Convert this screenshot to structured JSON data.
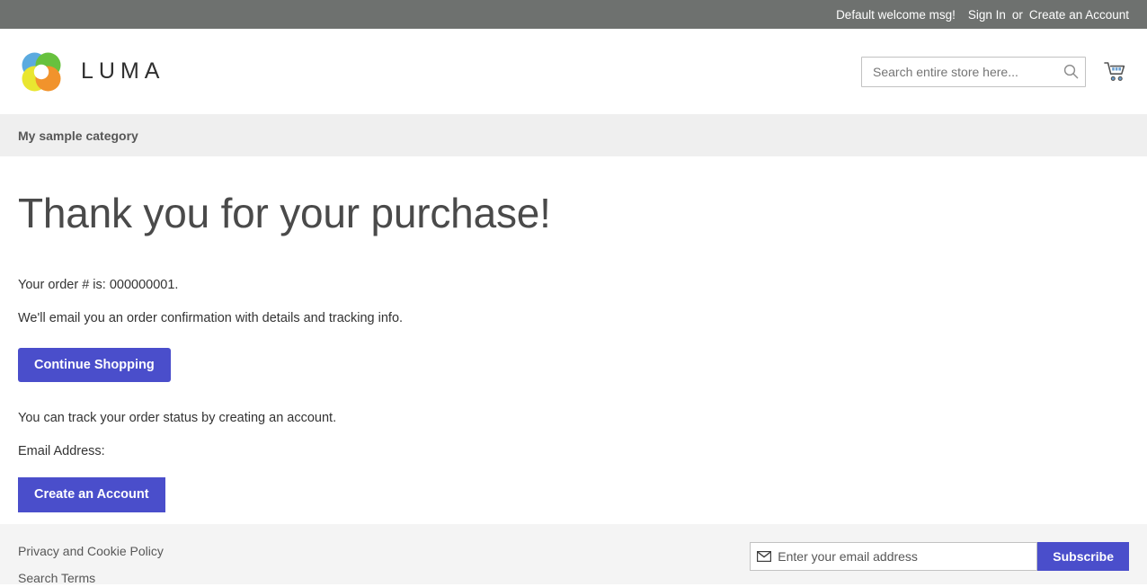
{
  "top_panel": {
    "welcome_message": "Default welcome msg!",
    "sign_in_label": "Sign In",
    "separator": "or",
    "create_account_label": "Create an Account"
  },
  "header": {
    "logo_text": "LUMA",
    "logo_icon": "luma-flower-logo",
    "search": {
      "placeholder": "Search entire store here...",
      "value": "",
      "icon": "search-icon"
    },
    "cart": {
      "icon": "shopping-cart-icon"
    }
  },
  "nav": {
    "items": [
      {
        "label": "My sample category"
      }
    ]
  },
  "main": {
    "page_title": "Thank you for your purchase!",
    "order_number_text": "Your order # is: 000000001.",
    "order_number": "000000001",
    "email_confirmation_text": "We'll email you an order confirmation with details and tracking info.",
    "continue_shopping_label": "Continue Shopping",
    "track_order_text": "You can track your order status by creating an account.",
    "email_address_label": "Email Address:",
    "email_address_value": "",
    "create_account_label": "Create an Account"
  },
  "footer": {
    "links": [
      {
        "label": "Privacy and Cookie Policy"
      },
      {
        "label": "Search Terms"
      }
    ],
    "newsletter": {
      "icon": "envelope-icon",
      "placeholder": "Enter your email address",
      "value": "",
      "subscribe_label": "Subscribe"
    }
  },
  "colors": {
    "top_panel_bg": "#6e716f",
    "nav_bg": "#efefef",
    "footer_bg": "#f4f4f4",
    "button_primary": "#4a4ecb",
    "heading": "#4a4a4a",
    "body_text": "#333333"
  }
}
